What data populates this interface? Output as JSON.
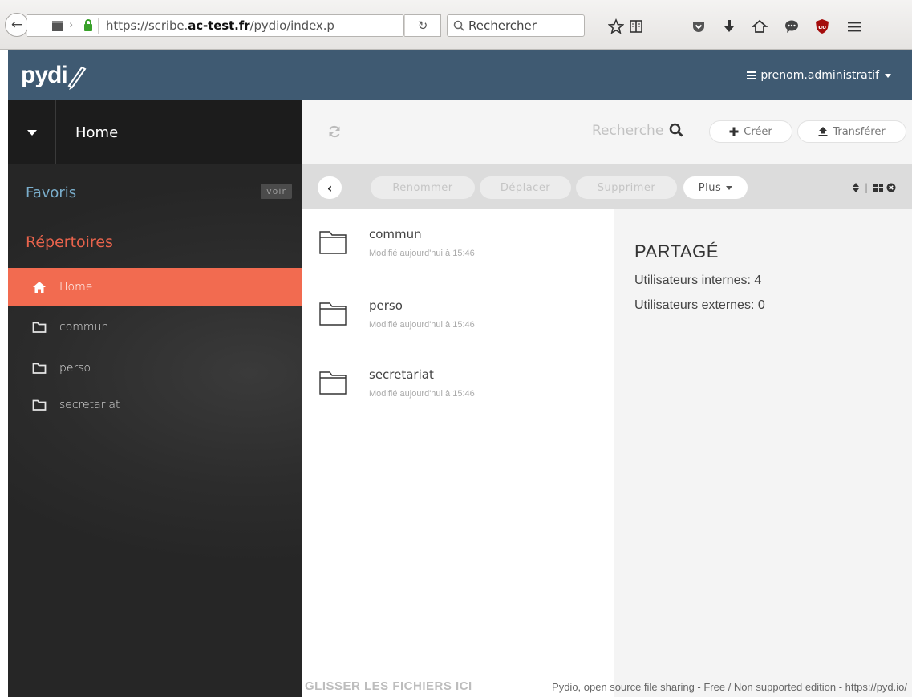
{
  "browser": {
    "url_prefix": "https://scribe.",
    "url_domain": "ac-test.fr",
    "url_suffix": "/pydio/index.p",
    "search_placeholder": "Rechercher",
    "icons": [
      "back-icon",
      "page-info-icon",
      "lock-icon",
      "reload-icon",
      "search-icon",
      "bookmark-star-icon",
      "reading-list-icon",
      "pocket-icon",
      "download-icon",
      "home-icon",
      "chat-icon",
      "ublock-icon",
      "menu-icon"
    ]
  },
  "app": {
    "logo": "pydio",
    "user_menu": "prenom.administratif"
  },
  "sidebar": {
    "workspace": "Home",
    "favorites_label": "Favoris",
    "favorites_badge": "voir",
    "repos_label": "Répertoires",
    "items": [
      {
        "label": "Home",
        "icon": "home-icon",
        "active": true
      },
      {
        "label": "commun",
        "icon": "folder-icon",
        "active": false
      },
      {
        "label": "perso",
        "icon": "folder-icon",
        "active": false
      },
      {
        "label": "secretariat",
        "icon": "folder-icon",
        "active": false
      }
    ]
  },
  "toolbar": {
    "search_label": "Recherche",
    "create_label": "Créer",
    "upload_label": "Transférer",
    "rename_label": "Renommer",
    "move_label": "Déplacer",
    "delete_label": "Supprimer",
    "more_label": "Plus"
  },
  "files": [
    {
      "name": "commun",
      "meta": "Modifié aujourd'hui à 15:46"
    },
    {
      "name": "perso",
      "meta": "Modifié aujourd'hui à 15:46"
    },
    {
      "name": "secretariat",
      "meta": "Modifié aujourd'hui à 15:46"
    }
  ],
  "info": {
    "title": "PARTAGÉ",
    "internal_users": "Utilisateurs internes: 4",
    "external_users": "Utilisateurs externes: 0"
  },
  "footer": {
    "drop_text": "GLISSER LES FICHIERS ICI",
    "credit": "Pydio, open source file sharing - Free / Non supported edition - https://pyd.io/"
  },
  "colors": {
    "header_bg": "#3f5a72",
    "sidebar_bg": "#2d2d2d",
    "active_item": "#f26b50",
    "favorites_accent": "#7aaecc",
    "repos_accent": "#e9634c"
  }
}
